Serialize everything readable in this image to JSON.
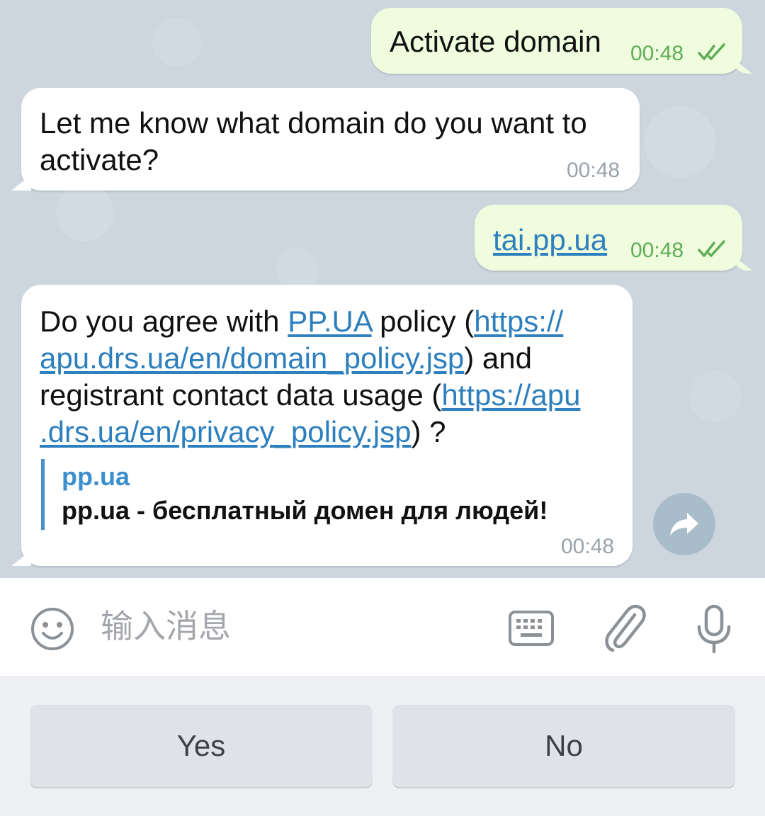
{
  "messages": [
    {
      "direction": "out",
      "text": "Activate domain",
      "time": "00:48",
      "status": "double-check-icon"
    },
    {
      "direction": "in",
      "text_line1": "Let me know what domain do you want to",
      "text_line2": "activate?",
      "time": "00:48"
    },
    {
      "direction": "out",
      "link": "tai.pp.ua",
      "time": "00:48",
      "status": "double-check-icon"
    },
    {
      "direction": "in",
      "p1": "Do you agree with ",
      "link1": "PP.UA",
      "p2": " policy (",
      "link2a": "https://",
      "link2b": "apu.drs.ua/en/domain_policy.jsp",
      "p3": ") and",
      "p4": "registrant contact data usage (",
      "link3a": "https://apu",
      "link3b": ".drs.ua/en/privacy_policy.jsp",
      "p5": ") ?",
      "preview_site": "pp.ua",
      "preview_desc": "pp.ua - бесплатный домен для людей!",
      "time": "00:48"
    }
  ],
  "input": {
    "placeholder": "输入消息",
    "emoji_icon": "emoji-icon",
    "keyboard_icon": "keyboard-icon",
    "attach_icon": "paperclip-icon",
    "mic_icon": "microphone-icon"
  },
  "share_icon": "share-arrow-icon",
  "reply_keyboard": {
    "yes_label": "Yes",
    "no_label": "No"
  },
  "colors": {
    "outgoing_bubble": "#effdde",
    "incoming_bubble": "#ffffff",
    "link": "#2d7fbd",
    "outgoing_time": "#5fad56",
    "chat_background": "#cdd6df"
  }
}
